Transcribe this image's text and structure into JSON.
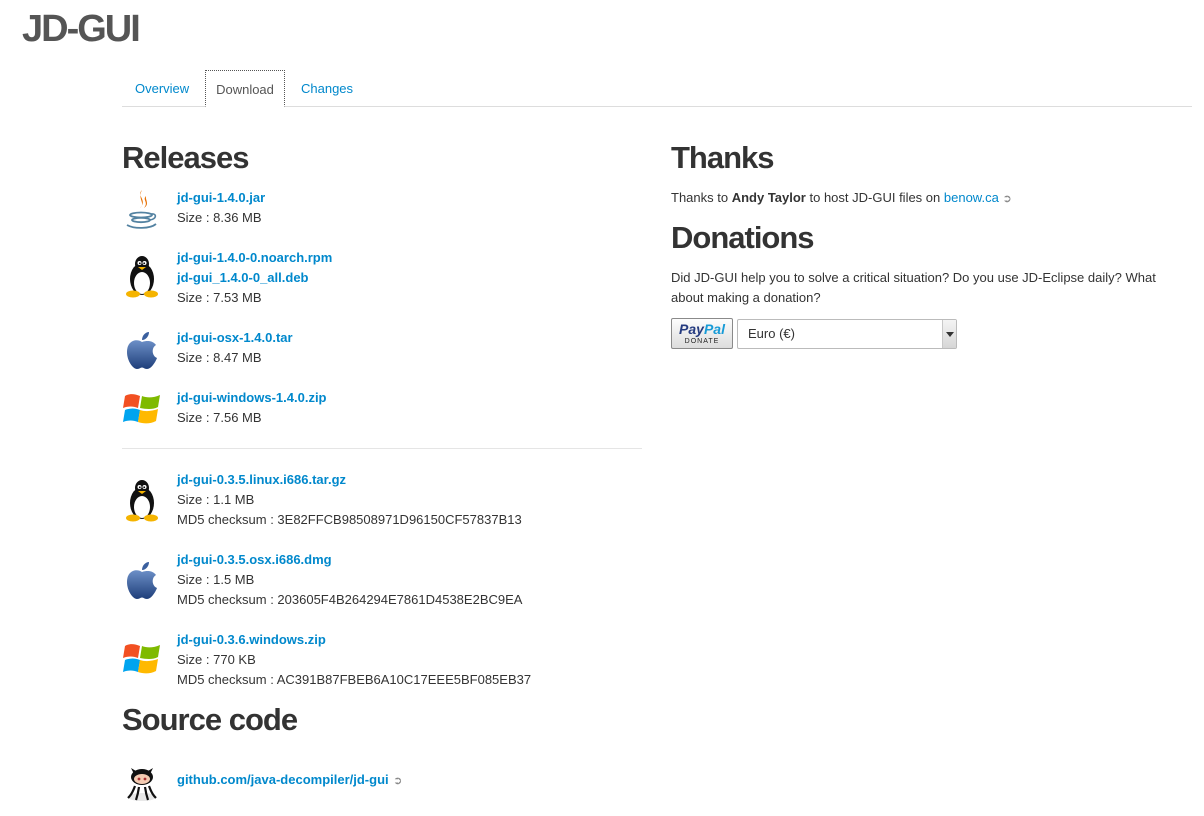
{
  "site": {
    "title": "JD-GUI"
  },
  "tabs": [
    {
      "label": "Overview",
      "active": false
    },
    {
      "label": "Download",
      "active": true
    },
    {
      "label": "Changes",
      "active": false
    }
  ],
  "releases": {
    "heading": "Releases",
    "current": [
      {
        "icon": "java-icon",
        "links": [
          "jd-gui-1.4.0.jar"
        ],
        "size": "Size : 8.36 MB"
      },
      {
        "icon": "linux-tux-icon",
        "links": [
          "jd-gui-1.4.0-0.noarch.rpm",
          "jd-gui_1.4.0-0_all.deb"
        ],
        "size": "Size : 7.53 MB"
      },
      {
        "icon": "apple-icon",
        "links": [
          "jd-gui-osx-1.4.0.tar"
        ],
        "size": "Size : 8.47 MB"
      },
      {
        "icon": "windows-icon",
        "links": [
          "jd-gui-windows-1.4.0.zip"
        ],
        "size": "Size : 7.56 MB"
      }
    ],
    "legacy": [
      {
        "icon": "linux-tux-icon",
        "link": "jd-gui-0.3.5.linux.i686.tar.gz",
        "size": "Size : 1.1 MB",
        "md5": "MD5 checksum : 3E82FFCB98508971D96150CF57837B13"
      },
      {
        "icon": "apple-icon",
        "link": "jd-gui-0.3.5.osx.i686.dmg",
        "size": "Size : 1.5 MB",
        "md5": "MD5 checksum : 203605F4B264294E7861D4538E2BC9EA"
      },
      {
        "icon": "windows-icon",
        "link": "jd-gui-0.3.6.windows.zip",
        "size": "Size : 770 KB",
        "md5": "MD5 checksum : AC391B87FBEB6A10C17EEE5BF085EB37"
      }
    ]
  },
  "source": {
    "heading": "Source code",
    "icon": "github-octocat-icon",
    "link": "github.com/java-decompiler/jd-gui"
  },
  "thanks": {
    "heading": "Thanks",
    "prefix": "Thanks to ",
    "name": "Andy Taylor",
    "middle": " to host JD-GUI files on ",
    "link": "benow.ca"
  },
  "donations": {
    "heading": "Donations",
    "text": "Did JD-GUI help you to solve a critical situation? Do you use JD-Eclipse daily? What about making a donation?",
    "paypal_word1": "Pay",
    "paypal_word2": "Pal",
    "paypal_donate": "DONATE",
    "currency_selected": "Euro (€)"
  },
  "colors": {
    "link": "#0088cc",
    "heading": "#333333",
    "title": "#555555"
  }
}
